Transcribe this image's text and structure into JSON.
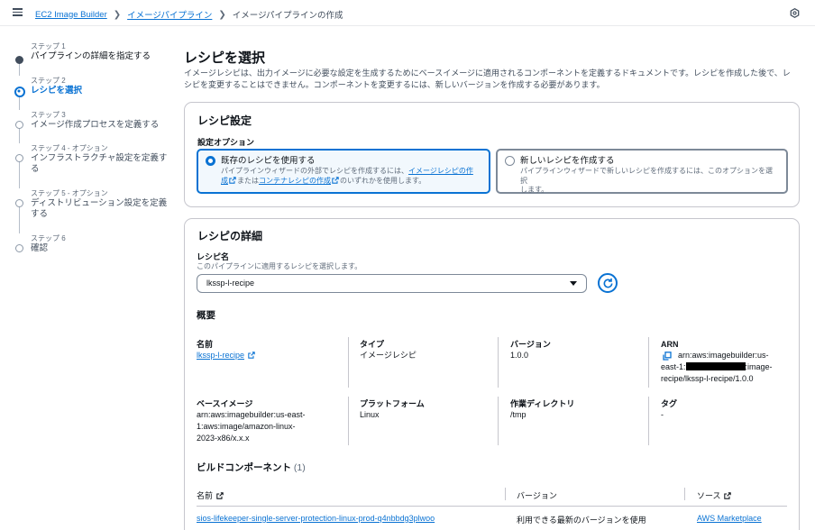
{
  "breadcrumb": {
    "items": [
      "EC2 Image Builder",
      "イメージパイプライン"
    ],
    "current": "イメージパイプラインの作成"
  },
  "steps": [
    {
      "sub": "ステップ 1",
      "title": "パイプラインの詳細を指定する",
      "state": "done"
    },
    {
      "sub": "ステップ 2",
      "title": "レシピを選択",
      "state": "active"
    },
    {
      "sub": "ステップ 3",
      "title": "イメージ作成プロセスを定義する",
      "state": "todo"
    },
    {
      "sub": "ステップ 4 - オプション",
      "title1": "インフラストラクチャ設定を定義す",
      "title2": "る",
      "state": "todo"
    },
    {
      "sub": "ステップ 5 - オプション",
      "title1": "ディストリビューション設定を定義",
      "title2": "する",
      "state": "todo"
    },
    {
      "sub": "ステップ 6",
      "title": "確認",
      "state": "todo"
    }
  ],
  "page": {
    "title": "レシピを選択",
    "description": "イメージレシピは、出力イメージに必要な設定を生成するためにベースイメージに適用されるコンポーネントを定義するドキュメントです。レシピを作成した後で、レシピを変更することはできません。コンポーネントを変更するには、新しいバージョンを作成する必要があります。"
  },
  "recipe_settings": {
    "title": "レシピ設定",
    "option_label": "設定オプション",
    "existing": {
      "title": "既存のレシピを使用する",
      "desc_prefix": "パイプラインウィザードの外部でレシピを作成するには、",
      "link1": "イメージレシピの作",
      "link1b": "成",
      "desc_mid": "または",
      "link2": "コンテナレシピの作成",
      "desc_suffix": "のいずれかを使用します。",
      "selected": true
    },
    "new": {
      "title": "新しいレシピを作成する",
      "desc1": "パイプラインウィザードで新しいレシピを作成するには、このオプションを選択",
      "desc2": "します。",
      "selected": false
    }
  },
  "recipe_details": {
    "title": "レシピの詳細",
    "name_label": "レシピ名",
    "name_desc": "このパイプラインに適用するレシピを選択します。",
    "selected_recipe": "lkssp-l-recipe",
    "summary_heading": "概要",
    "summary": {
      "name_label": "名前",
      "name_value": "lkssp-l-recipe",
      "type_label": "タイプ",
      "type_value": "イメージレシピ",
      "version_label": "バージョン",
      "version_value": "1.0.0",
      "arn_label": "ARN",
      "arn_line1": "arn:aws:imagebuilder:us-",
      "arn_line2a": "east-1:",
      "arn_line2b": ":image-",
      "arn_line3": "recipe/lkssp-l-recipe/1.0.0",
      "base_label": "ベースイメージ",
      "base_line1": "arn:aws:imagebuilder:us-east-",
      "base_line2": "1:aws:image/amazon-linux-",
      "base_line3": "2023-x86/x.x.x",
      "platform_label": "プラットフォーム",
      "platform_value": "Linux",
      "workdir_label": "作業ディレクトリ",
      "workdir_value": "/tmp",
      "tags_label": "タグ",
      "tags_value": "-"
    },
    "components_heading": "ビルドコンポーネント",
    "components_count": "(1)",
    "table": {
      "headers": [
        "名前",
        "バージョン",
        "ソース"
      ],
      "rows": [
        {
          "name": "sios-lifekeeper-single-server-protection-linux-prod-q4nbbdg3plwoo",
          "version": "利用できる最新のバージョンを使用",
          "source": "AWS Marketplace"
        }
      ]
    }
  },
  "colors": {
    "accent": "#0972d3",
    "text": "#0f141a",
    "muted": "#5f6b7a",
    "border": "#c6c6cd"
  }
}
